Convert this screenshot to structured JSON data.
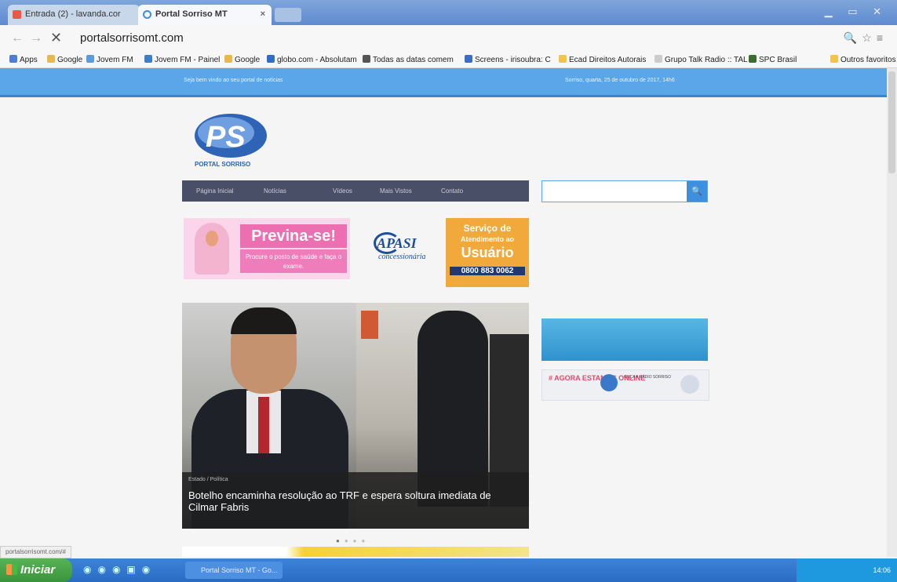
{
  "browser": {
    "tabs": [
      {
        "label": "Entrada (2) - lavanda.cor"
      },
      {
        "label": "Portal Sorriso MT",
        "active": true
      }
    ],
    "url": "portalsorrisomt.com",
    "bookmarks": [
      {
        "label": "Apps"
      },
      {
        "label": "Google"
      },
      {
        "label": "Jovem FM"
      },
      {
        "label": "Jovem FM - Painel"
      },
      {
        "label": "Google"
      },
      {
        "label": "globo.com - Absolutam"
      },
      {
        "label": "Todas as datas comem"
      },
      {
        "label": "Screens - irisoubra: C"
      },
      {
        "label": "Ecad Direitos Autorais"
      },
      {
        "label": "Grupo Talk Radio :: TAL"
      },
      {
        "label": "SPC Brasil"
      },
      {
        "label": "Outros favoritos"
      }
    ],
    "status_text": "portalsorrisomt.com/#"
  },
  "site": {
    "welcome": "Seja bem vindo ao seu portal de notícias",
    "date": "Sorriso, quarta, 25 de outubro de 2017, 14h6",
    "logo_text": "PORTAL SORRISO",
    "logo_letters": "PS",
    "menu": [
      "Página Inicial",
      "Notícias",
      "Vídeos",
      "Mais Vistos",
      "Contato"
    ],
    "search_placeholder": "",
    "ads": {
      "previna_title": "Previna-se!",
      "previna_sub": "Procure o posto de saúde e faça o exame.",
      "apasi": "APASI",
      "apasi_sub": "concessionária",
      "servico_l1": "Serviço de",
      "servico_l2": "Atendimento ao",
      "servico_l3": "Usuário",
      "servico_phone": "0800 883 0062"
    },
    "hero": {
      "category": "Estado / Política",
      "headline": "Botelho encaminha resolução ao TRF e espera soltura imediata de Cilmar Fabris"
    },
    "radio_banner": "",
    "online_text": "# AGORA ESTAMOS ONLINE",
    "online_detail": "OUÇA A RÁDIO SORRISO"
  },
  "taskbar": {
    "start_label": "Iniciar",
    "task_label": "Portal Sorriso MT - Go...",
    "clock": "14:06"
  }
}
